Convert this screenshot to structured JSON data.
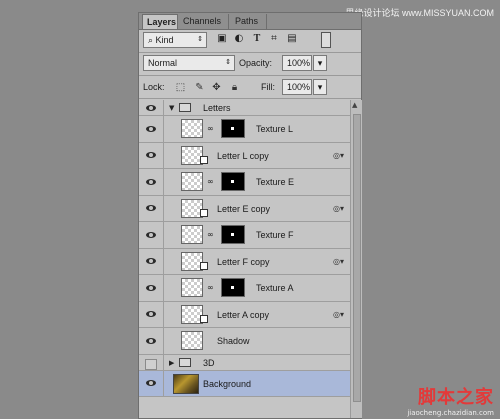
{
  "watermark_top": "思缘设计论坛  www.MISSYUAN.COM",
  "tabs": [
    "Layers",
    "Channels",
    "Paths"
  ],
  "filter": {
    "value": "Kind"
  },
  "blend": {
    "value": "Normal"
  },
  "opacity": {
    "label": "Opacity:",
    "value": "100%"
  },
  "lock": {
    "label": "Lock:"
  },
  "fill": {
    "label": "Fill:",
    "value": "100%"
  },
  "layers": [
    {
      "name": "Letters",
      "type": "group-open"
    },
    {
      "name": "Texture L",
      "type": "masked"
    },
    {
      "name": "Letter L copy",
      "type": "smart"
    },
    {
      "name": "Texture E",
      "type": "masked"
    },
    {
      "name": "Letter E copy",
      "type": "smart"
    },
    {
      "name": "Texture F",
      "type": "masked"
    },
    {
      "name": "Letter F copy",
      "type": "smart"
    },
    {
      "name": "Texture A",
      "type": "masked"
    },
    {
      "name": "Letter A copy",
      "type": "smart"
    },
    {
      "name": "Shadow",
      "type": "plain"
    },
    {
      "name": "3D",
      "type": "group-closed"
    },
    {
      "name": "Background",
      "type": "background"
    }
  ],
  "watermark_bottom": {
    "logo": "脚本之家",
    "url": "jiaocheng.chazidian.com"
  }
}
